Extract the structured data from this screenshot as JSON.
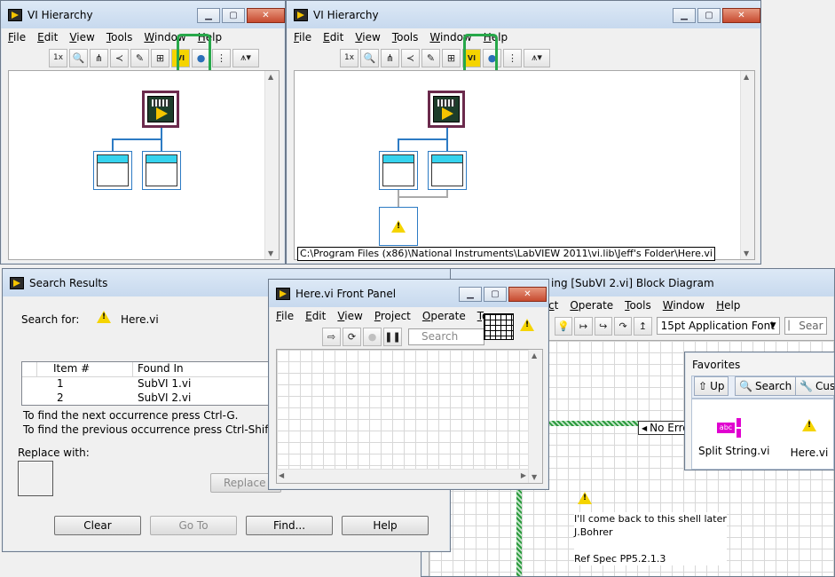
{
  "hier1": {
    "title": "VI Hierarchy",
    "menu": [
      "File",
      "Edit",
      "View",
      "Tools",
      "Window",
      "Help"
    ],
    "toolbar": {
      "zoom_label": "1x"
    }
  },
  "hier2": {
    "title": "VI Hierarchy",
    "menu": [
      "File",
      "Edit",
      "View",
      "Tools",
      "Window",
      "Help"
    ],
    "status_path": "C:\\Program Files (x86)\\National Instruments\\LabVIEW 2011\\vi.lib\\Jeff's Folder\\Here.vi"
  },
  "search_results": {
    "title": "Search Results",
    "search_for_label": "Search for:",
    "search_for_value": "Here.vi",
    "columns": [
      "Item #",
      "Found In"
    ],
    "rows": [
      {
        "item": "1",
        "found_in": "SubVI 1.vi"
      },
      {
        "item": "2",
        "found_in": "SubVI 2.vi"
      }
    ],
    "hint_next": "To find the next occurrence press Ctrl-G.",
    "hint_prev": "To find the previous occurrence press Ctrl-Shift-G.",
    "replace_with_label": "Replace with:",
    "replace_button": "Replace S",
    "buttons": {
      "clear": "Clear",
      "goto": "Go To",
      "find": "Find...",
      "help": "Help"
    }
  },
  "front_panel": {
    "title": "Here.vi Front Panel",
    "menu": [
      "File",
      "Edit",
      "View",
      "Project",
      "Operate",
      "To"
    ],
    "search_placeholder": "Search"
  },
  "block_diagram": {
    "title": "ing [SubVI 2.vi] Block Diagram",
    "menu": [
      "ct",
      "Operate",
      "Tools",
      "Window",
      "Help"
    ],
    "font_selector": "15pt Application Font",
    "search_partial": "Sear",
    "no_error_label": "No Erro",
    "comment_lines": [
      "I'll come back to this shell later",
      "J.Bohrer",
      "",
      "Ref  Spec PP5.2.1.3"
    ]
  },
  "favorites": {
    "title": "Favorites",
    "buttons": {
      "up": "Up",
      "search": "Search",
      "customize": "Cust"
    },
    "items": [
      {
        "label": "Split String.vi",
        "icon": "split-string-icon"
      },
      {
        "label": "Here.vi",
        "icon": "warning-icon"
      }
    ]
  },
  "colors": {
    "highlight": "#27a84a",
    "vi_border": "#6b2a4c",
    "link_blue": "#2d7bc4",
    "string_pink": "#e000d0"
  }
}
